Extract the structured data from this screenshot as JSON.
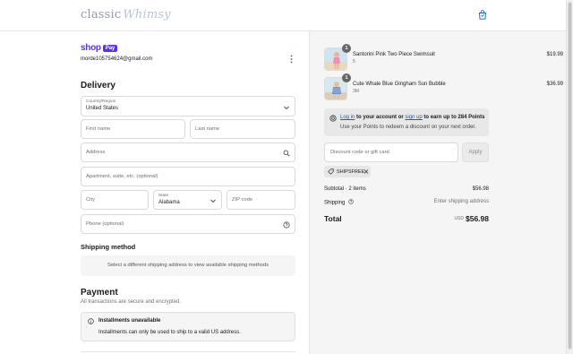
{
  "header": {
    "logo_main": "classic",
    "logo_script": "Whimsy",
    "cart_icon": "shopping-bag-icon"
  },
  "account": {
    "shop_label": "shop",
    "pay_label": "Pay",
    "email": "morde105754624@gmail.com",
    "menu_icon": "more-vertical-icon"
  },
  "delivery": {
    "title": "Delivery",
    "country_label": "Country/Region",
    "country_value": "United States",
    "first_name_placeholder": "First name",
    "last_name_placeholder": "Last name",
    "address_placeholder": "Address",
    "apartment_placeholder": "Apartment, suite, etc. (optional)",
    "city_placeholder": "City",
    "state_label": "State",
    "state_value": "Alabama",
    "zip_placeholder": "ZIP code",
    "phone_placeholder": "Phone (optional)"
  },
  "shipping": {
    "title": "Shipping method",
    "notice": "Select a different shipping address to view available shipping methods"
  },
  "payment": {
    "title": "Payment",
    "subtitle": "All transactions are secure and encrypted.",
    "installments_title": "Installments unavailable",
    "installments_text": "Installments can only be used to ship to a valid US address."
  },
  "order": {
    "items": [
      {
        "name": "Santorini Pink Two Piece Swimsuit",
        "variant": "5",
        "price": "$19.99",
        "quantity": "1"
      },
      {
        "name": "Cute Whale Blue Gingham Sun Bubble",
        "variant": "3M",
        "price": "$36.99",
        "quantity": "1"
      }
    ],
    "points_login": "Log in",
    "points_middle": " to your account or ",
    "points_signup": "sign up",
    "points_end": " to earn up to 284 Points",
    "points_line2": "Use your Points to redeem a discount on your next order.",
    "discount_placeholder": "Discount code or gift card",
    "apply_label": "Apply",
    "applied_code": "SHIPSFREE",
    "subtotal_label": "Subtotal · 2 items",
    "subtotal_value": "$56.98",
    "shipping_label": "Shipping",
    "shipping_value": "Enter shipping address",
    "total_label": "Total",
    "currency": "USD",
    "total_value": "$56.98"
  }
}
